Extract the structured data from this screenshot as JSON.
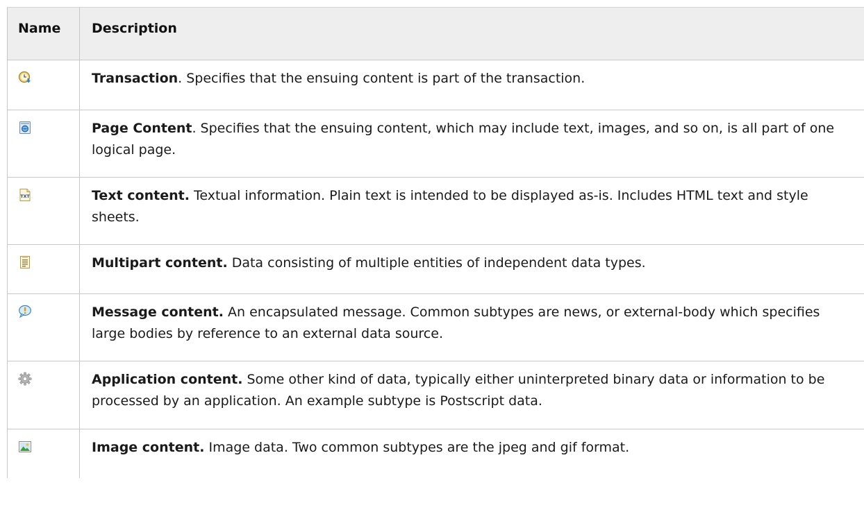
{
  "table": {
    "headers": {
      "name": "Name",
      "description": "Description"
    },
    "rows": [
      {
        "icon": "transaction-clock-icon",
        "term": "Transaction",
        "text": ". Specifies that the ensuing content is part of the transaction."
      },
      {
        "icon": "page-content-icon",
        "term": "Page Content",
        "text": ". Specifies that the ensuing content, which may include text, images, and so on, is all part of one logical page."
      },
      {
        "icon": "text-file-icon",
        "term": "Text content.",
        "text": " Textual information. Plain text is intended to be displayed as-is. Includes HTML text and style sheets."
      },
      {
        "icon": "multipart-document-icon",
        "term": "Multipart content.",
        "text": " Data consisting of multiple entities of independent data types."
      },
      {
        "icon": "message-bubble-icon",
        "term": "Message content.",
        "text": " An encapsulated message. Common subtypes are news, or external-body which specifies large bodies by reference to an external data source."
      },
      {
        "icon": "application-gear-icon",
        "term": "Application content.",
        "text": " Some other kind of data, typically either uninterpreted binary data or information to be processed by an application. An example subtype is Postscript data."
      },
      {
        "icon": "image-picture-icon",
        "term": "Image content.",
        "text": " Image data. Two common subtypes are the jpeg and gif format."
      }
    ]
  }
}
